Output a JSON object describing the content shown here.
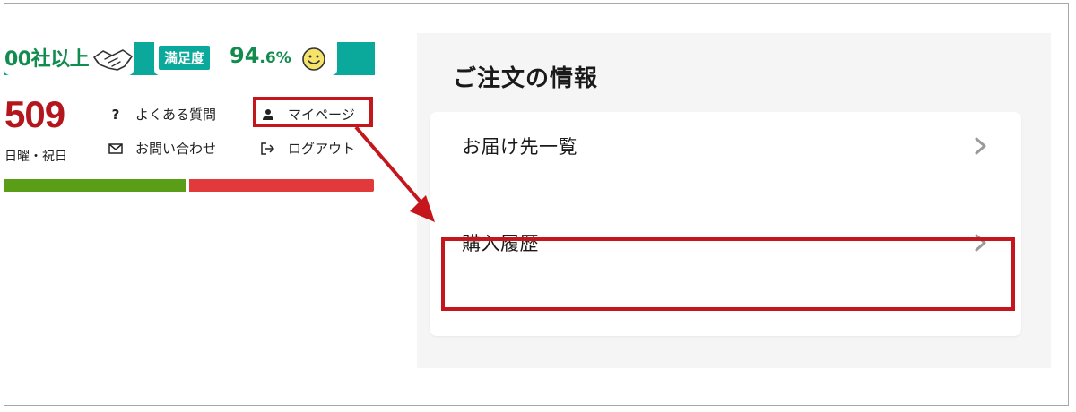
{
  "header": {
    "companies_count": "00社以上",
    "satisfaction_label": "満足度",
    "satisfaction_int": "94",
    "satisfaction_dec": ".6%",
    "phone_tail": "509",
    "hours": "日曜・祝日",
    "icons": {
      "handshake": "handshake-icon",
      "smile": "smile-icon"
    }
  },
  "nav": {
    "faq": {
      "label": "よくある質問",
      "icon": "?"
    },
    "mypage": {
      "label": "マイページ",
      "icon": "person-icon"
    },
    "contact": {
      "label": "お問い合わせ",
      "icon": "envelope-icon"
    },
    "logout": {
      "label": "ログアウト",
      "icon": "logout-icon"
    }
  },
  "order_info": {
    "title": "ご注文の情報",
    "items": [
      {
        "label": "お届け先一覧"
      },
      {
        "label": "購入履歴"
      }
    ]
  },
  "colors": {
    "teal": "#0ba99b",
    "green_text": "#128c4e",
    "red_accent": "#c4161c",
    "bar_green": "#5a9e17",
    "bar_red": "#e2393b",
    "panel_bg": "#f5f5f5"
  }
}
